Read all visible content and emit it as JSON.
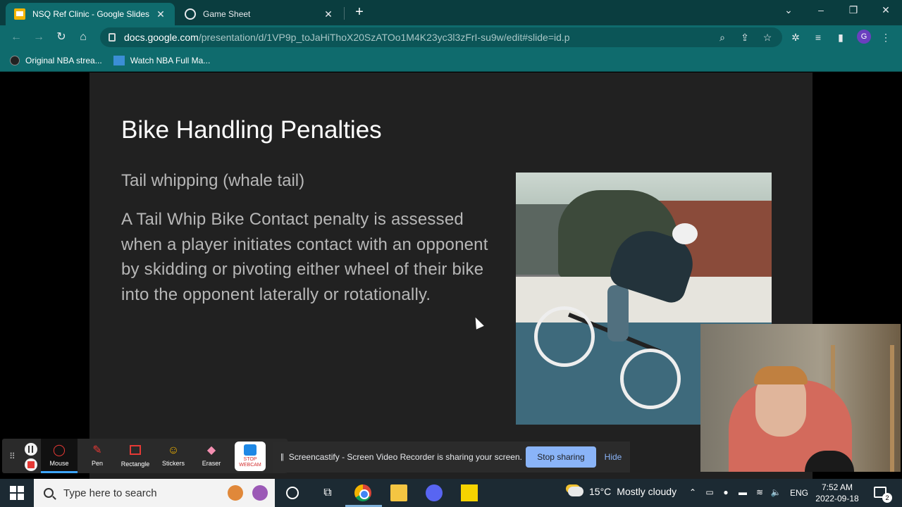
{
  "browser": {
    "tabs": [
      {
        "title": "NSQ Ref Clinic - Google Slides",
        "favicon": "google-slides-icon",
        "active": true
      },
      {
        "title": "Game Sheet",
        "favicon": "globe-icon",
        "active": false
      }
    ],
    "new_tab_glyph": "+",
    "tab_close_glyph": "✕",
    "window_controls": {
      "tab_search": "⌄",
      "minimize": "–",
      "restore": "❐",
      "close": "✕"
    },
    "nav": {
      "back": "←",
      "forward": "→",
      "reload": "↻",
      "home": "⌂"
    },
    "url_host": "docs.google.com",
    "url_path": "/presentation/d/1VP9p_toJaHiThoX20SzATOo1M4K23yc3l3zFrI-su9w/edit#slide=id.p",
    "toolbar_icons": {
      "zoom": "⌕",
      "share": "⇪",
      "bookmark": "☆",
      "extensions": "✲",
      "media": "≡",
      "sidepanel": "▮",
      "menu": "⋮"
    },
    "profile_initial": "G",
    "bookmarks": [
      {
        "label": "Original NBA strea...",
        "icon": "basketball-icon"
      },
      {
        "label": "Watch NBA Full Ma...",
        "icon": "image-icon"
      }
    ]
  },
  "slide": {
    "title": "Bike Handling Penalties",
    "subtitle": "Tail whipping (whale tail)",
    "body": "A Tail Whip Bike Contact penalty is assessed when a player initiates contact with an opponent by skidding or pivoting either wheel of their bike into the opponent laterally or rotationally."
  },
  "screencastify": {
    "grip": "⠿",
    "tools": [
      {
        "label": "Mouse",
        "icon": "mouse-cursor-icon",
        "active": true,
        "glyph": "◯"
      },
      {
        "label": "Pen",
        "icon": "pen-icon",
        "active": false,
        "glyph": "✎"
      },
      {
        "label": "Rectangle",
        "icon": "rectangle-icon",
        "active": false,
        "glyph": ""
      },
      {
        "label": "Stickers",
        "icon": "smiley-icon",
        "active": false,
        "glyph": "☺"
      },
      {
        "label": "Eraser",
        "icon": "eraser-icon",
        "active": false,
        "glyph": "◆"
      }
    ],
    "stop_webcam_label": "STOP WEBCAM"
  },
  "share_banner": {
    "pause_glyph": "||",
    "message": "Screencastify - Screen Video Recorder is sharing your screen.",
    "stop_label": "Stop sharing",
    "hide_label": "Hide"
  },
  "taskbar": {
    "search_placeholder": "Type here to search",
    "task_view_glyph": "⧉",
    "weather_temp": "15°C",
    "weather_desc": "Mostly cloudy",
    "tray": {
      "chevron": "⌃",
      "meet": "▭",
      "mic": "●",
      "battery": "▬",
      "volume": "🔈",
      "wifi": "≋"
    },
    "language": "ENG",
    "time": "7:52 AM",
    "date": "2022-09-18",
    "notification_count": "2"
  },
  "colors": {
    "tab_strip": "#0a3d3f",
    "toolbar": "#0f6b6d",
    "slide_bg": "#212121",
    "stop_sharing": "#8ab4f8"
  }
}
